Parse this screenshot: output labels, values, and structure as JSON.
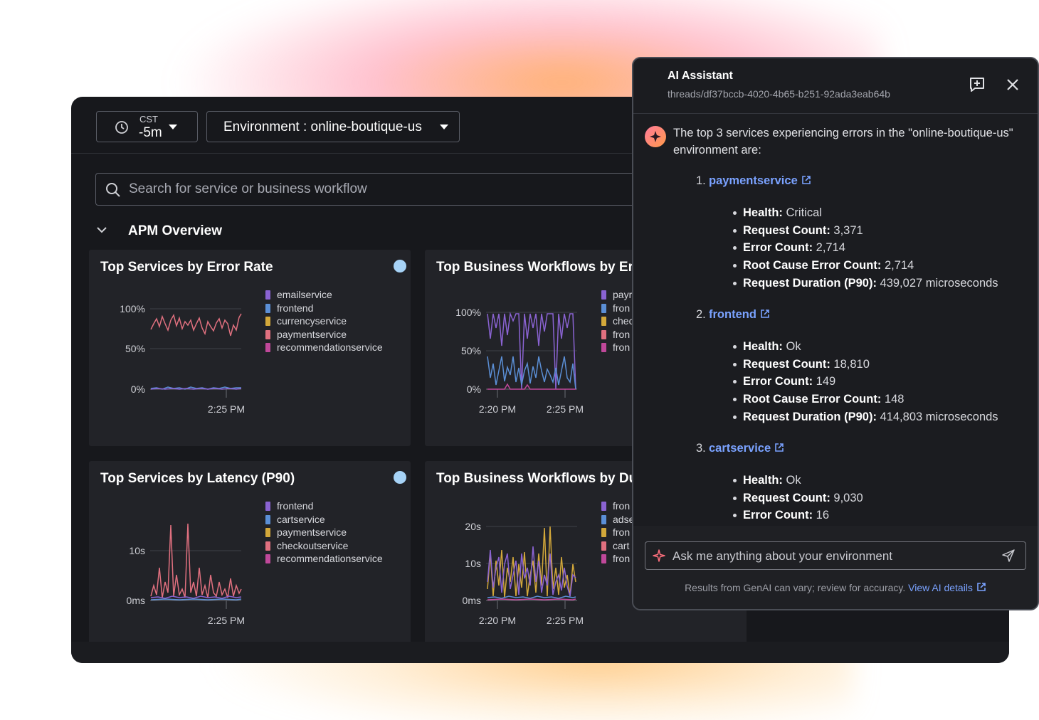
{
  "toolbar": {
    "timezone": "CST",
    "time_range": "-5m",
    "environment_label": "Environment : online-boutique-us"
  },
  "search": {
    "placeholder": "Search for service or business workflow"
  },
  "section": {
    "title": "APM Overview"
  },
  "cards": [
    {
      "title": "Top Services by Error Rate",
      "y_ticks": [
        "100%",
        "50%",
        "0%"
      ],
      "x_ticks": [
        "2:25 PM"
      ],
      "legend": [
        {
          "label": "emailservice",
          "color": "#8a63d2"
        },
        {
          "label": "frontend",
          "color": "#5b8fd6"
        },
        {
          "label": "currencyservice",
          "color": "#d3a83a"
        },
        {
          "label": "paymentservice",
          "color": "#e0707f"
        },
        {
          "label": "recommendationservice",
          "color": "#c0489a"
        }
      ]
    },
    {
      "title": "Top Business Workflows by Er",
      "y_ticks": [
        "100%",
        "50%",
        "0%"
      ],
      "x_ticks": [
        "2:20 PM",
        "2:25 PM"
      ],
      "legend": [
        {
          "label": "payr",
          "color": "#8a63d2"
        },
        {
          "label": "fron",
          "color": "#5b8fd6"
        },
        {
          "label": "chec",
          "color": "#d3a83a"
        },
        {
          "label": "fron",
          "color": "#e0707f"
        },
        {
          "label": "fron",
          "color": "#c0489a"
        }
      ]
    },
    {
      "title": "Top Services by Latency (P90)",
      "y_ticks": [
        "10s",
        "0ms"
      ],
      "x_ticks": [
        "2:25 PM"
      ],
      "legend": [
        {
          "label": "frontend",
          "color": "#8a63d2"
        },
        {
          "label": "cartservice",
          "color": "#5b8fd6"
        },
        {
          "label": "paymentservice",
          "color": "#d3a83a"
        },
        {
          "label": "checkoutservice",
          "color": "#e0707f"
        },
        {
          "label": "recommendationservice",
          "color": "#c0489a"
        }
      ]
    },
    {
      "title": "Top Business Workflows by Du",
      "y_ticks": [
        "20s",
        "10s",
        "0ms"
      ],
      "x_ticks": [
        "2:20 PM",
        "2:25 PM"
      ],
      "legend": [
        {
          "label": "fron",
          "color": "#8a63d2"
        },
        {
          "label": "adse",
          "color": "#5b8fd6"
        },
        {
          "label": "fron",
          "color": "#d3a83a"
        },
        {
          "label": "cart",
          "color": "#e0707f"
        },
        {
          "label": "fron",
          "color": "#c0489a"
        }
      ]
    }
  ],
  "ai": {
    "title": "AI Assistant",
    "thread": "threads/df37bccb-4020-4b65-b251-92ada3eab64b",
    "intro": "The top 3 services experiencing errors in the \"online-boutique-us\" environment are:",
    "services": [
      {
        "num": "1.",
        "name": "paymentservice",
        "fields": [
          {
            "k": "Health:",
            "v": "Critical"
          },
          {
            "k": "Request Count:",
            "v": "3,371"
          },
          {
            "k": "Error Count:",
            "v": "2,714"
          },
          {
            "k": "Root Cause Error Count:",
            "v": "2,714"
          },
          {
            "k": "Request Duration (P90):",
            "v": "439,027 microseconds"
          }
        ]
      },
      {
        "num": "2.",
        "name": "frontend",
        "fields": [
          {
            "k": "Health:",
            "v": "Ok"
          },
          {
            "k": "Request Count:",
            "v": "18,810"
          },
          {
            "k": "Error Count:",
            "v": "149"
          },
          {
            "k": "Root Cause Error Count:",
            "v": "148"
          },
          {
            "k": "Request Duration (P90):",
            "v": "414,803 microseconds"
          }
        ]
      },
      {
        "num": "3.",
        "name": "cartservice",
        "fields": [
          {
            "k": "Health:",
            "v": "Ok"
          },
          {
            "k": "Request Count:",
            "v": "9,030"
          },
          {
            "k": "Error Count:",
            "v": "16"
          }
        ]
      }
    ],
    "input_placeholder": "Ask me anything about your environment",
    "disclaimer": "Results from GenAI can vary; review for accuracy.",
    "details_link": "View AI details"
  }
}
